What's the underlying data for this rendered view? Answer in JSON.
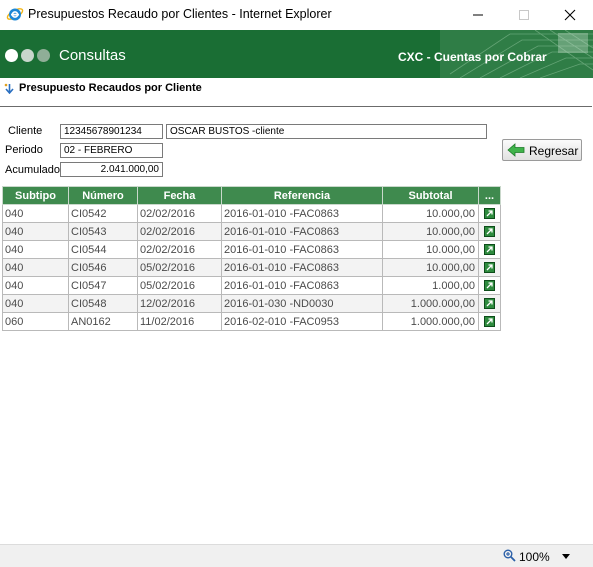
{
  "window": {
    "title": "Presupuestos Recaudo por Clientes - Internet Explorer"
  },
  "banner": {
    "app_label": "Consultas",
    "module_label": "CXC - Cuentas por Cobrar",
    "dot_colors": [
      "#ffffff",
      "#c9d6cc",
      "#8fae97"
    ]
  },
  "page": {
    "heading": "Presupuesto Recaudos por Cliente"
  },
  "form": {
    "cliente_label": "Cliente",
    "cliente_id": "12345678901234",
    "cliente_name": "OSCAR BUSTOS -cliente",
    "periodo_label": "Periodo",
    "periodo_value": "02 - FEBRERO",
    "acumulado_label": "Acumulado",
    "acumulado_value": "2.041.000,00",
    "back_button": "Regresar"
  },
  "table": {
    "headers": [
      "Subtipo",
      "Número",
      "Fecha",
      "Referencia",
      "Subtotal",
      "..."
    ],
    "rows": [
      {
        "subtipo": "040",
        "numero": "CI0542",
        "fecha": "02/02/2016",
        "referencia": "2016-01-010 -FAC0863",
        "subtotal": "10.000,00"
      },
      {
        "subtipo": "040",
        "numero": "CI0543",
        "fecha": "02/02/2016",
        "referencia": "2016-01-010 -FAC0863",
        "subtotal": "10.000,00"
      },
      {
        "subtipo": "040",
        "numero": "CI0544",
        "fecha": "02/02/2016",
        "referencia": "2016-01-010 -FAC0863",
        "subtotal": "10.000,00"
      },
      {
        "subtipo": "040",
        "numero": "CI0546",
        "fecha": "05/02/2016",
        "referencia": "2016-01-010 -FAC0863",
        "subtotal": "10.000,00"
      },
      {
        "subtipo": "040",
        "numero": "CI0547",
        "fecha": "05/02/2016",
        "referencia": "2016-01-010 -FAC0863",
        "subtotal": "1.000,00"
      },
      {
        "subtipo": "040",
        "numero": "CI0548",
        "fecha": "12/02/2016",
        "referencia": "2016-01-030 -ND0030",
        "subtotal": "1.000.000,00"
      },
      {
        "subtipo": "060",
        "numero": "AN0162",
        "fecha": "11/02/2016",
        "referencia": "2016-02-010 -FAC0953",
        "subtotal": "1.000.000,00"
      }
    ],
    "row_action_icon": "open-detail-icon"
  },
  "statusbar": {
    "zoom": "100%"
  },
  "colors": {
    "banner": "#1a6e34",
    "table_header": "#3f8a4e"
  }
}
